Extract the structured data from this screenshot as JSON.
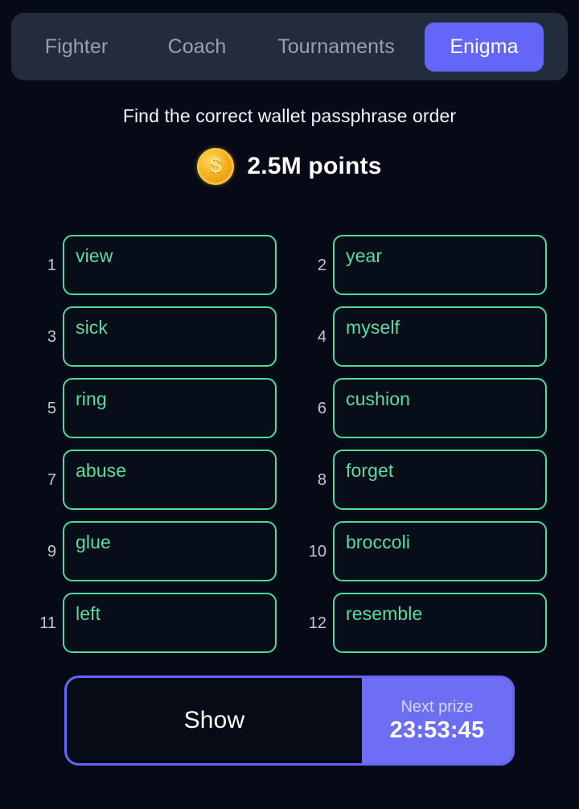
{
  "theme": {
    "page_bg": "#060a16",
    "tabbar_bg": "#232c3d",
    "accent_purple": "#6366f8",
    "tile_border_green": "#4ade9b",
    "word_text_green": "#5bdca0",
    "index_text": "#c2c7d6",
    "coin_gold": "#f7b320"
  },
  "tabs": [
    {
      "label": "Fighter",
      "active": false
    },
    {
      "label": "Coach",
      "active": false
    },
    {
      "label": "Tournaments",
      "active": false
    },
    {
      "label": "Enigma",
      "active": true
    }
  ],
  "header": {
    "prompt": "Find the correct wallet passphrase order",
    "coin_icon": "coin-dollar-icon",
    "coin_glyph": "$",
    "points": "2.5M points"
  },
  "passphrase": {
    "words": [
      {
        "index": "1",
        "word": "view"
      },
      {
        "index": "2",
        "word": "year"
      },
      {
        "index": "3",
        "word": "sick"
      },
      {
        "index": "4",
        "word": "myself"
      },
      {
        "index": "5",
        "word": "ring"
      },
      {
        "index": "6",
        "word": "cushion"
      },
      {
        "index": "7",
        "word": "abuse"
      },
      {
        "index": "8",
        "word": "forget"
      },
      {
        "index": "9",
        "word": "glue"
      },
      {
        "index": "10",
        "word": "broccoli"
      },
      {
        "index": "11",
        "word": "left"
      },
      {
        "index": "12",
        "word": "resemble"
      }
    ]
  },
  "footer": {
    "show_label": "Show",
    "prize_label": "Next prize",
    "prize_timer": "23:53:45"
  }
}
